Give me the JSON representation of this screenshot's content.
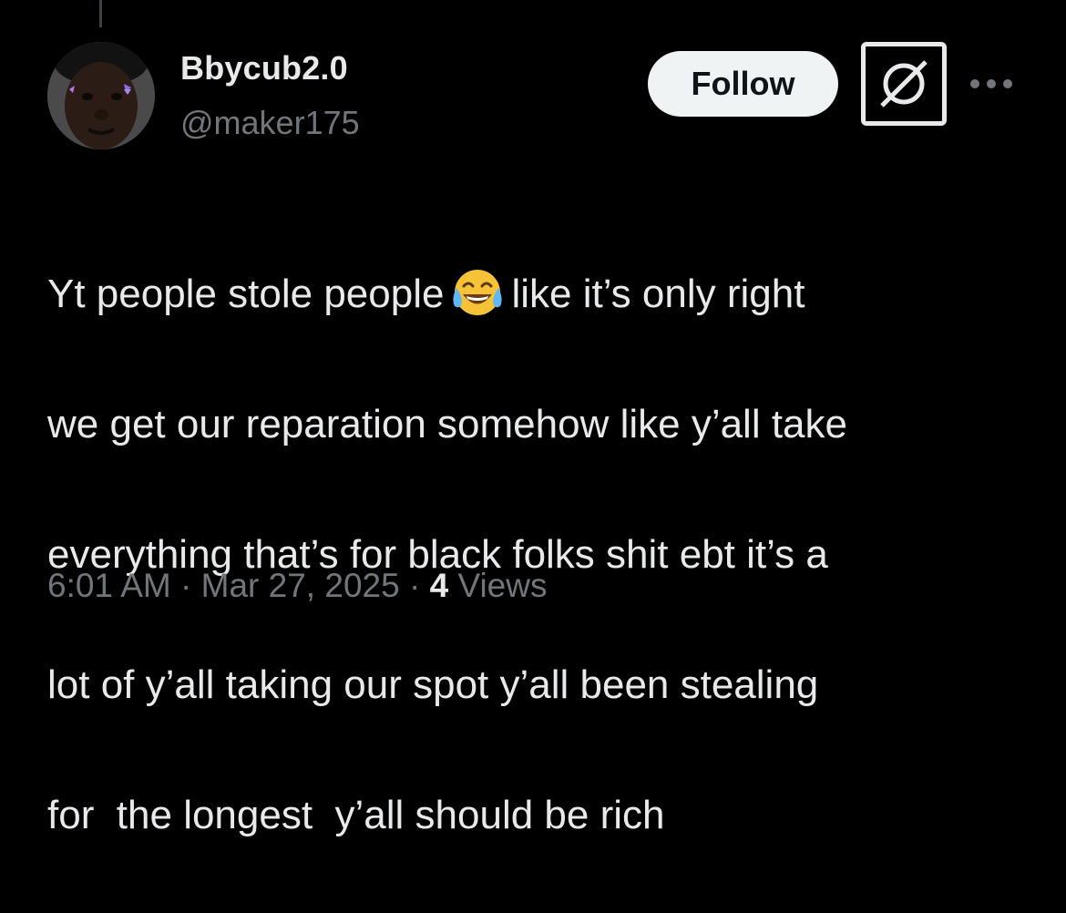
{
  "author": {
    "display_name": "Bbycub2.0",
    "handle": "@maker175",
    "avatar": "profile-photo"
  },
  "actions": {
    "follow_label": "Follow",
    "grok_icon": "grok-icon",
    "more_icon": "more-icon"
  },
  "tweet": {
    "lines": [
      {
        "before": "Yt people stole people",
        "emoji": "face-with-tears-of-joy",
        "after": "like it’s only right"
      },
      {
        "text": "we get our reparation somehow like y’all take"
      },
      {
        "text": "everything that’s for black folks shit ebt it’s a"
      },
      {
        "text": "lot of y’all taking our spot y’all been stealing"
      },
      {
        "text": "for  the longest  y’all should be rich"
      }
    ]
  },
  "meta": {
    "time": "6:01 AM",
    "separator": "·",
    "date": "Mar 27, 2025",
    "views_count": "4",
    "views_label": "Views"
  },
  "colors": {
    "background": "#000000",
    "primary_text": "#e7e9ea",
    "secondary_text": "#71767b",
    "follow_button_bg": "#eff3f4",
    "follow_button_text": "#0f1419"
  }
}
